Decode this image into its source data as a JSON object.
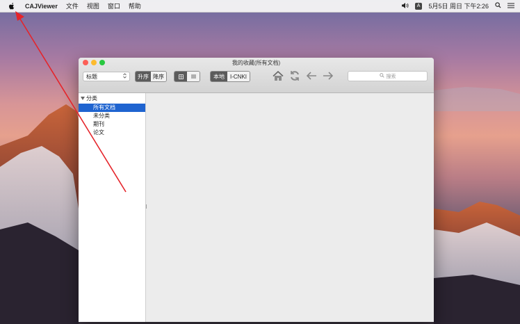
{
  "menubar": {
    "app_name": "CAJViewer",
    "menus": [
      "文件",
      "视图",
      "窗口",
      "帮助"
    ],
    "input_method": "A",
    "datetime": "5月5日 周日 下午2:26"
  },
  "window": {
    "title": "我的收藏(所有文档)",
    "toolbar": {
      "sort_field": "标题",
      "sort_order": [
        "升序",
        "降序"
      ],
      "library": [
        "本地",
        "I-CNKI"
      ],
      "search_placeholder": "搜索"
    },
    "sidebar": {
      "root": "分类",
      "items": [
        "所有文档",
        "未分类",
        "期刊",
        "论文"
      ],
      "selected_index": 0
    }
  }
}
